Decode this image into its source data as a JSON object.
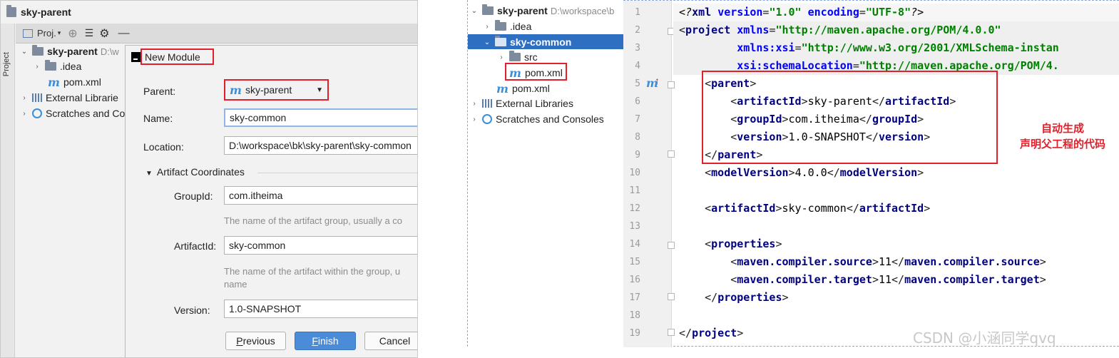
{
  "left": {
    "title": "sky-parent",
    "side_tab": "Project",
    "toolbar_label": "Proj.",
    "tree": [
      {
        "label": "sky-parent",
        "path": "D:\\w"
      },
      {
        "label": ".idea"
      },
      {
        "label": "pom.xml"
      },
      {
        "label": "External Librarie"
      },
      {
        "label": "Scratches and Co"
      }
    ]
  },
  "dialog": {
    "title": "New Module",
    "parent_label": "Parent:",
    "parent_value": "sky-parent",
    "name_label": "Name:",
    "name_value": "sky-common",
    "location_label": "Location:",
    "location_value": "D:\\workspace\\bk\\sky-parent\\sky-common",
    "artifact_section": "Artifact Coordinates",
    "groupid_label": "GroupId:",
    "groupid_value": "com.itheima",
    "groupid_hint": "The name of the artifact group, usually a co",
    "artifactid_label": "ArtifactId:",
    "artifactid_value": "sky-common",
    "artifactid_hint_1": "The name of the artifact within the group, u",
    "artifactid_hint_2": "name",
    "version_label": "Version:",
    "version_value": "1.0-SNAPSHOT",
    "btn_previous_rest": "revious",
    "btn_previous_mnemonic": "P",
    "btn_finish_mnemonic": "F",
    "btn_finish_rest": "inish",
    "btn_cancel": "Cancel"
  },
  "right_tree": [
    {
      "label": "sky-parent",
      "path": "D:\\workspace\\b"
    },
    {
      "label": ".idea"
    },
    {
      "label": "sky-common"
    },
    {
      "label": "src"
    },
    {
      "label": "pom.xml"
    },
    {
      "label": "pom.xml"
    },
    {
      "label": "External Libraries"
    },
    {
      "label": "Scratches and Consoles"
    }
  ],
  "editor": {
    "line_numbers": [
      "1",
      "2",
      "3",
      "4",
      "5",
      "6",
      "7",
      "8",
      "9",
      "10",
      "11",
      "12",
      "13",
      "14",
      "15",
      "16",
      "17",
      "18",
      "19"
    ],
    "gutter_marker": "m",
    "xml": {
      "pi_open": "<?",
      "pi_name": "xml",
      "version_attr": "version",
      "version_val": "\"1.0\"",
      "encoding_attr": "encoding",
      "encoding_val": "\"UTF-8\"",
      "pi_close": "?>",
      "project": "project",
      "xmlns_attr": "xmlns",
      "xmlns_val": "\"http://maven.apache.org/POM/4.0.0\"",
      "xsi_attr": "xmlns:xsi",
      "xsi_val": "\"http://www.w3.org/2001/XMLSchema-instan",
      "schema_attr": "xsi:schemaLocation",
      "schema_val": "\"http://maven.apache.org/POM/4.",
      "parent": "parent",
      "artifactId": "artifactId",
      "groupId": "groupId",
      "version": "version",
      "parent_artifact": "sky-parent",
      "parent_group": "com.itheima",
      "parent_version": "1.0-SNAPSHOT",
      "modelVersion": "modelVersion",
      "model_value": "4.0.0",
      "module_artifact": "sky-common",
      "properties": "properties",
      "src_prop": "maven.compiler.source",
      "tgt_prop": "maven.compiler.target",
      "src_val": "11",
      "tgt_val": "11"
    }
  },
  "annotation": {
    "line1": "自动生成",
    "line2": "声明父工程的代码"
  },
  "watermark": "CSDN @小涵同学qvq",
  "colors": {
    "highlight_red": "#e0212b",
    "selection_blue": "#2f6fc2",
    "primary_button": "#4a8cd8",
    "xml_tag": "#000080",
    "xml_value": "#008000"
  }
}
